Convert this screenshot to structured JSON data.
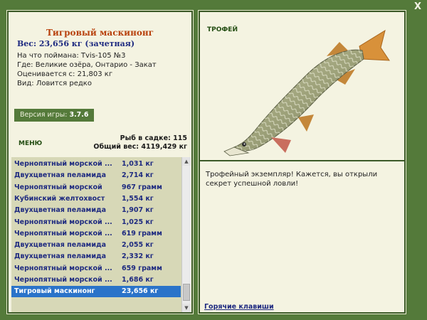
{
  "window": {
    "close_glyph": "X"
  },
  "fish": {
    "title": "Тигровый маскинонг",
    "weight": "Вес: 23,656 кг (зачетная)",
    "caught_with": "На что поймана: Tvis-105 №3",
    "location": "Где: Великие озёра, Онтарио - Закат",
    "value": "Оценивается с: 21,803 кг",
    "rarity": "Вид: Ловится редко"
  },
  "version": {
    "label": "Версия игры:",
    "value": "3.7.6"
  },
  "menu_label": "МЕНЮ",
  "stats": {
    "count": "Рыб в садке: 115",
    "total": "Общий вес: 4119,429 кг"
  },
  "catch_list": [
    {
      "name": "Чернопятный морской ...",
      "weight": "1,031 кг"
    },
    {
      "name": "Двухцветная пеламида",
      "weight": "2,714 кг"
    },
    {
      "name": "Чернопятный морской",
      "weight": "967 грамм"
    },
    {
      "name": "Кубинский желтохвост",
      "weight": "1,554 кг"
    },
    {
      "name": "Двухцветная пеламида",
      "weight": "1,907 кг"
    },
    {
      "name": "Чернопятный морской ...",
      "weight": "1,025 кг"
    },
    {
      "name": "Чернопятный морской ...",
      "weight": "619 грамм"
    },
    {
      "name": "Двухцветная пеламида",
      "weight": "2,055 кг"
    },
    {
      "name": "Двухцветная пеламида",
      "weight": "2,332 кг"
    },
    {
      "name": "Чернопятный морской ...",
      "weight": "659 грамм"
    },
    {
      "name": "Чернопятный морской ...",
      "weight": "1,686 кг"
    },
    {
      "name": "Тигровый маскинонг",
      "weight": "23,656 кг"
    }
  ],
  "selected_index": 11,
  "trophy": {
    "label": "ТРОФЕЙ",
    "text": "Трофейный экземпляр! Кажется, вы открыли секрет успешной ловли!"
  },
  "hotkeys_label": "Горячие клавиши",
  "icons": {
    "close": "close-icon",
    "scroll_up": "arrow-up-icon",
    "scroll_down": "arrow-down-icon"
  },
  "colors": {
    "background": "#547a3a",
    "panel": "#f4f3e1",
    "title": "#b8420e",
    "link": "#1e2a80",
    "selection": "#2a73c9"
  }
}
